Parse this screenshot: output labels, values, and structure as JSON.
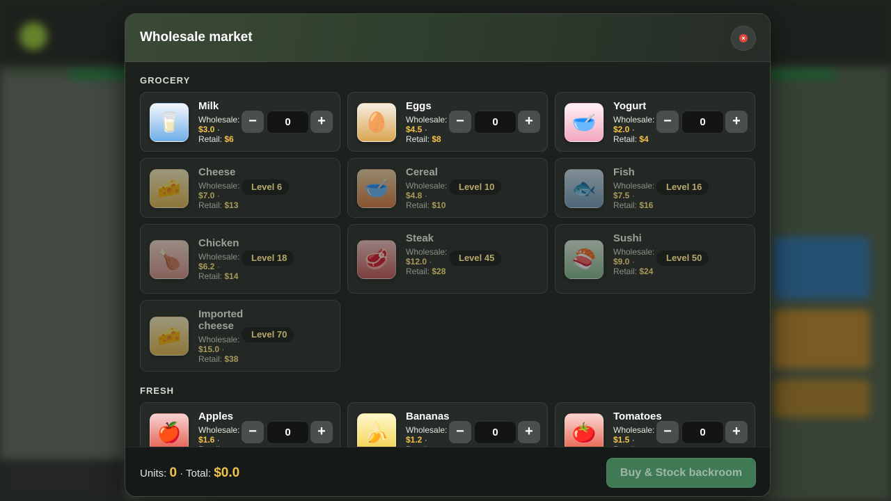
{
  "modal": {
    "title": "Wholesale market",
    "close_symbol": "×"
  },
  "sections": [
    {
      "title": "GROCERY"
    },
    {
      "title": "FRESH"
    }
  ],
  "labels": {
    "wholesale": "Wholesale:",
    "retail": "Retail:",
    "minus": "−",
    "plus": "+"
  },
  "items": [
    {
      "name": "Milk",
      "wholesale": "$3.0",
      "retail": "$6",
      "qty": "0",
      "icon": "🥛",
      "icon_name": "milk-icon",
      "locked": false
    },
    {
      "name": "Eggs",
      "wholesale": "$4.5",
      "retail": "$8",
      "qty": "0",
      "icon": "🥚",
      "icon_name": "egg-icon",
      "locked": false
    },
    {
      "name": "Yogurt",
      "wholesale": "$2.0",
      "retail": "$4",
      "qty": "0",
      "icon": "🥣",
      "icon_name": "yogurt-icon",
      "locked": false
    },
    {
      "name": "Cheese",
      "wholesale": "$7.0",
      "retail": "$13",
      "level": "Level 6",
      "icon": "🧀",
      "icon_name": "cheese-icon",
      "locked": true
    },
    {
      "name": "Cereal",
      "wholesale": "$4.8",
      "retail": "$10",
      "level": "Level 10",
      "icon": "🥣",
      "icon_name": "cereal-icon",
      "locked": true
    },
    {
      "name": "Fish",
      "wholesale": "$7.5",
      "retail": "$16",
      "level": "Level 16",
      "icon": "🐟",
      "icon_name": "fish-icon",
      "locked": true
    },
    {
      "name": "Chicken",
      "wholesale": "$6.2",
      "retail": "$14",
      "level": "Level 18",
      "icon": "🍗",
      "icon_name": "chicken-icon",
      "locked": true
    },
    {
      "name": "Steak",
      "wholesale": "$12.0",
      "retail": "$28",
      "level": "Level 45",
      "icon": "🥩",
      "icon_name": "steak-icon",
      "locked": true
    },
    {
      "name": "Sushi",
      "wholesale": "$9.0",
      "retail": "$24",
      "level": "Level 50",
      "icon": "🍣",
      "icon_name": "sushi-icon",
      "locked": true
    },
    {
      "name": "Imported cheese",
      "wholesale": "$15.0",
      "retail": "$38",
      "level": "Level 70",
      "icon": "🧀",
      "icon_name": "imported-cheese-icon",
      "locked": true
    },
    {
      "name": "Apples",
      "wholesale": "$1.6",
      "retail": "",
      "qty": "0",
      "icon": "🍎",
      "icon_name": "apple-icon",
      "locked": false
    },
    {
      "name": "Bananas",
      "wholesale": "$1.2",
      "retail": "",
      "qty": "0",
      "icon": "🍌",
      "icon_name": "banana-icon",
      "locked": false
    },
    {
      "name": "Tomatoes",
      "wholesale": "$1.5",
      "retail": "",
      "qty": "0",
      "icon": "🍅",
      "icon_name": "tomato-icon",
      "locked": false
    }
  ],
  "footer": {
    "units_label": "Units:",
    "units_value": "0",
    "separator": "·",
    "total_label": "Total:",
    "total_value": "$0.0",
    "buy_label": "Buy & Stock backroom"
  },
  "colors": {
    "accent_price": "#f4c24a",
    "buy_button": "#3f7a55",
    "close_button": "#e04a3c"
  }
}
